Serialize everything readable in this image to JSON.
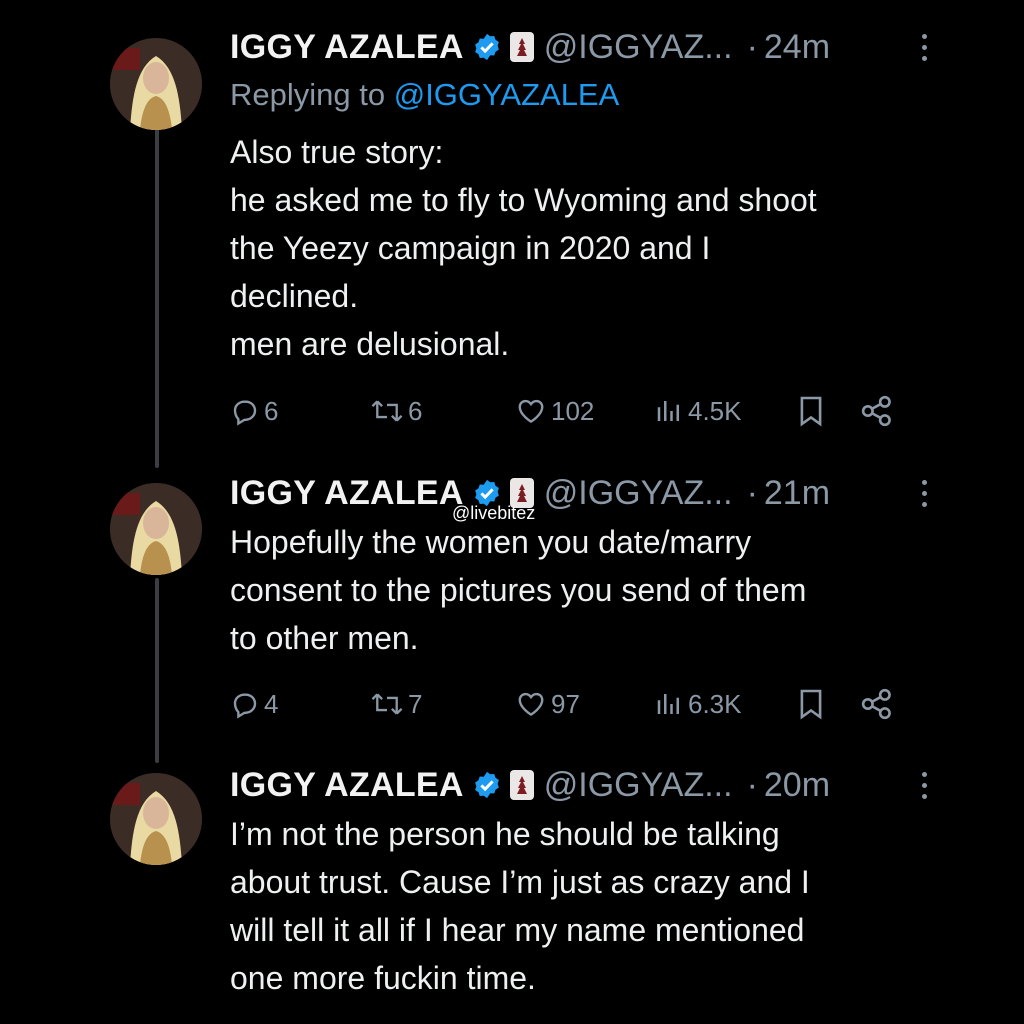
{
  "tweets": [
    {
      "name": "IGGY AZALEA",
      "handle": "@IGGYAZ...",
      "time": "24m",
      "replying_prefix": "Replying to",
      "replying_to": "@IGGYAZALEA",
      "lines": [
        "Also true story:",
        "he asked me to fly to Wyoming and shoot",
        "the Yeezy campaign in 2020 and I",
        "declined.",
        "men are delusional."
      ],
      "replies": "6",
      "reposts": "6",
      "likes": "102",
      "views": "4.5K"
    },
    {
      "name": "IGGY AZALEA",
      "handle": "@IGGYAZ...",
      "time": "21m",
      "lines": [
        "Hopefully the women you date/marry",
        "consent to the pictures you send of them",
        "to other men."
      ],
      "replies": "4",
      "reposts": "7",
      "likes": "97",
      "views": "6.3K"
    },
    {
      "name": "IGGY AZALEA",
      "handle": "@IGGYAZ...",
      "time": "20m",
      "lines": [
        "I’m not the person he should be talking",
        "about trust. Cause I’m just as crazy and I",
        "will tell it all if I hear my name mentioned",
        "one more fuckin time."
      ]
    }
  ],
  "separator": "·",
  "watermark": "@livebitez",
  "colors": {
    "background": "#000000",
    "text": "#e7e9ea",
    "muted": "#8b98a5",
    "link": "#1d9bf0",
    "verified": "#1d9bf0",
    "thread_line": "#3a3d41"
  },
  "icons": [
    "reply-icon",
    "repost-icon",
    "like-icon",
    "views-icon",
    "bookmark-icon",
    "share-icon",
    "verified-icon",
    "more-icon"
  ]
}
